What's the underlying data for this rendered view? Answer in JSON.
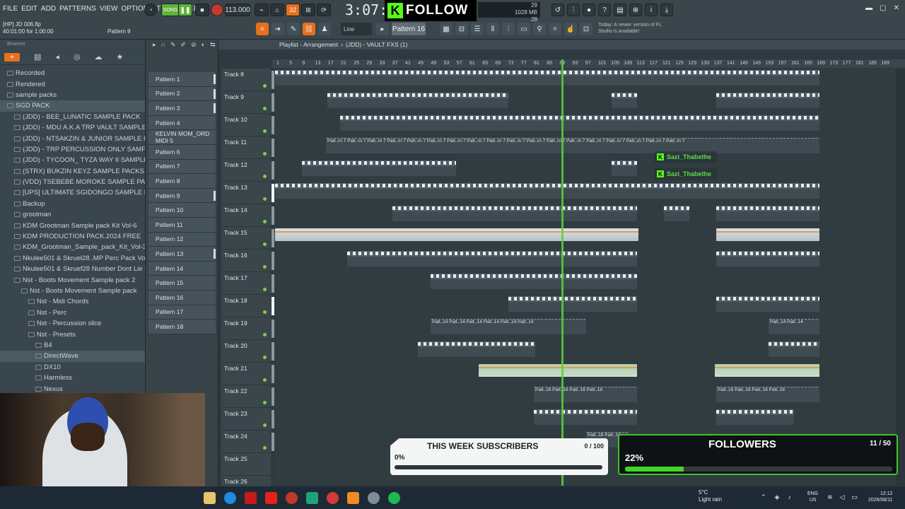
{
  "menu": [
    "FILE",
    "EDIT",
    "ADD",
    "PATTERNS",
    "VIEW",
    "OPTIONS",
    "TOOLS",
    "HELP"
  ],
  "project": {
    "file": "[HP] JD 006.flp",
    "time_range": "40:01:00 for 1:00:00",
    "pattern_label": "Pattern 9"
  },
  "transport": {
    "mode": "SONG",
    "tempo": "113.000",
    "time": "3:07:",
    "time_unit": "32"
  },
  "kick_follow": {
    "text": "FOLLOW"
  },
  "memory": {
    "cpu": "29",
    "ram": "1028 MB",
    "polyphony": "28"
  },
  "toolbar2": {
    "snap": "Line",
    "pattern": "Pattern 16",
    "notice": "Today: A newer version of FL Studio is available!"
  },
  "browser": {
    "title": "Browser",
    "items": [
      {
        "label": "Recorded",
        "level": 0
      },
      {
        "label": "Rendered",
        "level": 0
      },
      {
        "label": "sample packs",
        "level": 0
      },
      {
        "label": "SGD PACK",
        "level": 0,
        "selected": true
      },
      {
        "label": "(JDD) - BEE_LUNATIC SAMPLE PACK",
        "level": 1
      },
      {
        "label": "(JDD) - MDU A.K.A TRP VAULT SAMPLE PACK",
        "level": 1
      },
      {
        "label": "(JDD) - NTSAKZIN & JUNIOR SAMPLE PACK",
        "level": 1
      },
      {
        "label": "(JDD) - TRP PERCUSSION ONLY SAMPLE PACK",
        "level": 1
      },
      {
        "label": "(JDD) - TYCOON_ TYZA WAY II SAMPLE PACK",
        "level": 1
      },
      {
        "label": "(STRX) BUKZIN KEYZ SAMPLE PACKS",
        "level": 1
      },
      {
        "label": "(VDD) TSEBEBE MOROKE SAMPLE PACK",
        "level": 1
      },
      {
        "label": "[UPS] ULTIMATE SGIDONGO SAMPLE PACK",
        "level": 1
      },
      {
        "label": "Backup",
        "level": 1
      },
      {
        "label": "grootman",
        "level": 1
      },
      {
        "label": "KDM Grootman Sample pack Kit Vol-6",
        "level": 1
      },
      {
        "label": "KDM PRODUCTION PACK.2024 FREE",
        "level": 1
      },
      {
        "label": "KDM_Grootman_Sample_pack_Kit_Vol-3",
        "level": 1
      },
      {
        "label": "Nkulee501 & Skrueł28..MP Perc Pack Vol 3(2)",
        "level": 1
      },
      {
        "label": "Nkulee501 & Skruef28 Number Dont Lie Pack",
        "level": 1
      },
      {
        "label": "Nst - Boots Movement Sample pack 2",
        "level": 1
      },
      {
        "label": "Nst - Boots Movement Sample pack",
        "level": 2
      },
      {
        "label": "Nst - Midi Chords",
        "level": 3
      },
      {
        "label": "Nst - Perc",
        "level": 3
      },
      {
        "label": "Nst - Percussion slice",
        "level": 3
      },
      {
        "label": "Nst - Presets",
        "level": 3
      },
      {
        "label": "B4",
        "level": 4
      },
      {
        "label": "DirectWave",
        "level": 4,
        "selected": true
      },
      {
        "label": "DX10",
        "level": 4
      },
      {
        "label": "Harmless",
        "level": 4
      },
      {
        "label": "Nexus",
        "level": 4
      }
    ]
  },
  "patterns": [
    "Pattern 1",
    "Pattern 2",
    "Pattern 3",
    "Pattern 4",
    "KELVIN MOM_ORD MIDI 5",
    "Pattern 6",
    "Pattern 7",
    "Pattern 8",
    "Pattern 9",
    "Pattern 10",
    "Pattern 11",
    "Pattern 12",
    "Pattern 13",
    "Pattern 14",
    "Pattern 15",
    "Pattern 16",
    "Pattern 17",
    "Pattern 18"
  ],
  "playlist": {
    "title": "Playlist - Arrangement",
    "breadcrumb": "(JDD) - VAULT FXS (1)",
    "ruler": [
      "1",
      "5",
      "9",
      "13",
      "17",
      "21",
      "25",
      "29",
      "33",
      "37",
      "41",
      "45",
      "49",
      "53",
      "57",
      "61",
      "65",
      "69",
      "73",
      "77",
      "81",
      "85",
      "89",
      "93",
      "97",
      "101",
      "105",
      "109",
      "113",
      "117",
      "121",
      "125",
      "129",
      "133",
      "137",
      "141",
      "145",
      "149",
      "153",
      "157",
      "161",
      "165",
      "169",
      "173",
      "177",
      "181",
      "185",
      "189"
    ],
    "tracks": [
      "Track 8",
      "Track 9",
      "Track 10",
      "Track 11",
      "Track 12",
      "Track 13",
      "Track 14",
      "Track 15",
      "Track 16",
      "Track 17",
      "Track 18",
      "Track 19",
      "Track 20",
      "Track 21",
      "Track 22",
      "Track 23",
      "Track 24",
      "Track 25",
      "Track 26"
    ],
    "clip_labels": {
      "t11": "Patt..rn 7",
      "t19": "Patt..14",
      "t22": "Patt..16",
      "t24": "Patt..18"
    }
  },
  "chat": [
    {
      "user": "Sazi_Thabethe",
      "msg": ""
    },
    {
      "user": "Sazi_Thabethe",
      "msg": ""
    }
  ],
  "subscribers": {
    "title": "THIS WEEK SUBSCRIBERS",
    "count": "0 / 100",
    "percent": "0%",
    "progress": 0
  },
  "followers": {
    "title": "FOLLOWERS",
    "count": "11 / 50",
    "percent": "22%",
    "progress": 0.22
  },
  "taskbar": {
    "temp": "5°C",
    "weather": "Light rain",
    "lang1": "ENG",
    "lang2": "US",
    "time": "12:12",
    "date": "2026/08/11"
  }
}
